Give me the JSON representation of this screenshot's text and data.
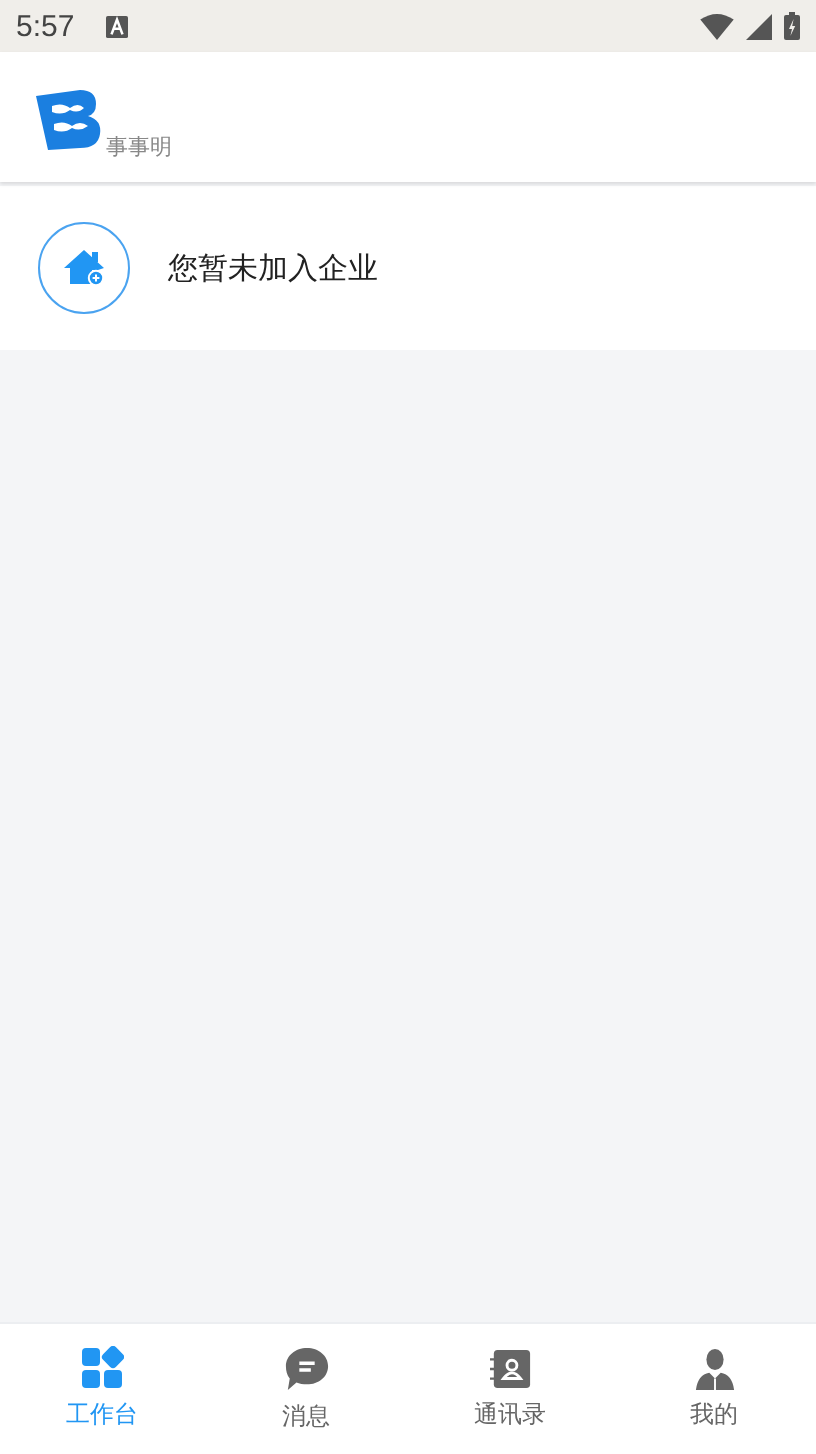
{
  "status_bar": {
    "time": "5:57"
  },
  "header": {
    "app_name": "事事明"
  },
  "notice": {
    "text": "您暂未加入企业"
  },
  "tabs": [
    {
      "label": "工作台",
      "kind": "apps",
      "selected": true
    },
    {
      "label": "消息",
      "kind": "chat",
      "selected": false
    },
    {
      "label": "通讯录",
      "kind": "contacts",
      "selected": false
    },
    {
      "label": "我的",
      "kind": "person",
      "selected": false
    }
  ]
}
